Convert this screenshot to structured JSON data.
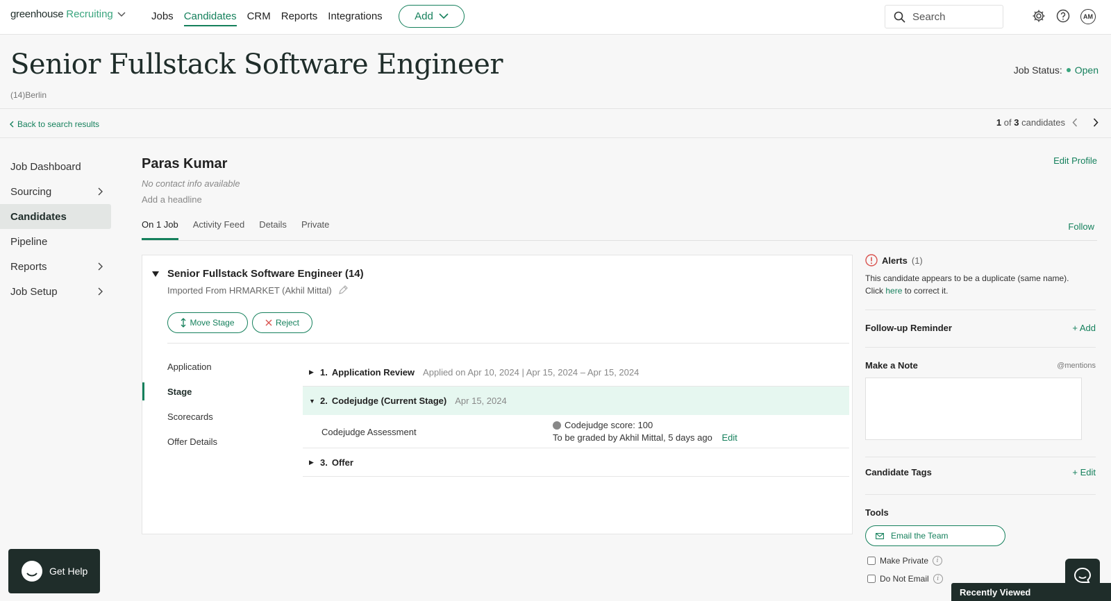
{
  "nav": {
    "brand_main": "greenhouse",
    "brand_product": "Recruiting",
    "links": [
      "Jobs",
      "Candidates",
      "CRM",
      "Reports",
      "Integrations"
    ],
    "active_link": "Candidates",
    "add_label": "Add",
    "search_placeholder": "Search",
    "avatar_initials": "AM"
  },
  "header": {
    "job_title": "Senior Fullstack Software Engineer",
    "job_subtitle": "(14)Berlin",
    "status_label": "Job Status:",
    "status_value": "Open",
    "back_link": "Back to search results",
    "pager_current": "1",
    "pager_of": "of",
    "pager_total": "3",
    "pager_suffix": "candidates"
  },
  "sidebar": {
    "items": [
      {
        "label": "Job Dashboard",
        "has_chevron": false
      },
      {
        "label": "Sourcing",
        "has_chevron": true
      },
      {
        "label": "Candidates",
        "has_chevron": false,
        "active": true
      },
      {
        "label": "Pipeline",
        "has_chevron": false
      },
      {
        "label": "Reports",
        "has_chevron": true
      },
      {
        "label": "Job Setup",
        "has_chevron": true
      }
    ]
  },
  "candidate": {
    "name": "Paras Kumar",
    "contact": "No contact info available",
    "headline_placeholder": "Add a headline",
    "edit_profile": "Edit Profile",
    "follow": "Follow",
    "tabs": [
      "On 1 Job",
      "Activity Feed",
      "Details",
      "Private"
    ],
    "active_tab": "On 1 Job"
  },
  "job_card": {
    "title": "Senior Fullstack Software Engineer (14)",
    "source": "Imported From HRMARKET (Akhil Mittal)",
    "move_stage": "Move Stage",
    "reject": "Reject",
    "subnav": [
      "Application",
      "Stage",
      "Scorecards",
      "Offer Details"
    ],
    "active_subnav": "Stage",
    "stages": [
      {
        "number": "1.",
        "name": "Application Review",
        "meta": "Applied on Apr 10, 2024 | Apr 15, 2024 – Apr 15, 2024"
      },
      {
        "number": "2.",
        "name": "Codejudge (Current Stage)",
        "meta": "Apr 15, 2024"
      },
      {
        "number": "3.",
        "name": "Offer",
        "meta": ""
      }
    ],
    "assessment": {
      "name": "Codejudge Assessment",
      "score": "Codejudge score: 100",
      "grading": "To be graded by Akhil Mittal, 5 days ago",
      "edit": "Edit"
    }
  },
  "right_panel": {
    "alerts_title": "Alerts",
    "alerts_count": "(1)",
    "alert_text_1": "This candidate appears to be a duplicate (same name).",
    "alert_text_2_pre": "Click",
    "alert_text_2_link": "here",
    "alert_text_2_post": "to correct it.",
    "followup_title": "Follow-up Reminder",
    "followup_action": "+ Add",
    "note_title": "Make a Note",
    "note_mentions": "@mentions",
    "tags_title": "Candidate Tags",
    "tags_action": "+ Edit",
    "tools_title": "Tools",
    "email_team": "Email the Team",
    "make_private": "Make Private",
    "do_not_email": "Do Not Email"
  },
  "widgets": {
    "get_help": "Get Help",
    "recently_viewed": "Recently Viewed"
  },
  "colors": {
    "accent": "#15805c",
    "dark": "#1f2d2a",
    "current_stage_bg": "#e6f7f0",
    "alert": "#d9534f"
  }
}
